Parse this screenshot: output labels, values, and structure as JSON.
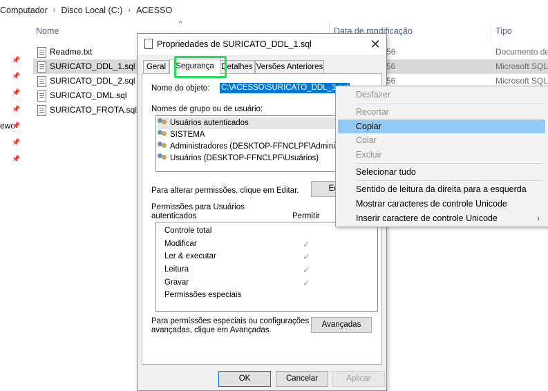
{
  "explorer": {
    "breadcrumb": [
      "Computador",
      "Disco Local (C:)",
      "ACESSO"
    ],
    "breadcrumb_sep": "›",
    "columns": {
      "name": "Nome",
      "date": "Data de modificação",
      "type": "Tipo"
    },
    "left_partial_text": "ewo",
    "files": [
      {
        "name": "Readme.txt",
        "date": "56",
        "type": "Documento de"
      },
      {
        "name": "SURICATO_DDL_1.sql",
        "date": "56",
        "type": "Microsoft SQL"
      },
      {
        "name": "SURICATO_DDL_2.sql",
        "date": "56",
        "type": "Microsoft SQL"
      },
      {
        "name": "SURICATO_DML.sql",
        "date": "",
        "type": ""
      },
      {
        "name": "SURICATO_FROTA.sql",
        "date": "",
        "type": ""
      }
    ]
  },
  "dialog": {
    "title": "Propriedades de SURICATO_DDL_1.sql",
    "close_glyph": "✕",
    "tabs": [
      "Geral",
      "Segurança",
      "Detalhes",
      "Versões Anteriores"
    ],
    "object_label": "Nome do objeto:",
    "object_value": "C:\\ACESSO\\SURICATO_DDL_1.sql",
    "groups_label": "Nomes de grupo ou de usuário:",
    "groups": [
      "Usuários autenticados",
      "SISTEMA",
      "Administradores (DESKTOP-FFNCLPF\\Administradores)",
      "Usuários (DESKTOP-FFNCLPF\\Usuários)"
    ],
    "change_hint": "Para alterar permissões, clique em Editar.",
    "edit_button": "Editar...",
    "perm_label_line1": "Permissões para Usuários",
    "perm_label_line2": "autenticados",
    "allow_header": "Permitir",
    "permissions": [
      {
        "name": "Controle total",
        "allowed": false
      },
      {
        "name": "Modificar",
        "allowed": true
      },
      {
        "name": "Ler & executar",
        "allowed": true
      },
      {
        "name": "Leitura",
        "allowed": true
      },
      {
        "name": "Gravar",
        "allowed": true
      },
      {
        "name": "Permissões especiais",
        "allowed": false
      }
    ],
    "special_hint_line1": "Para permissões especiais ou configurações",
    "special_hint_line2": "avançadas, clique em Avançadas.",
    "advanced_button": "Avançadas",
    "ok_button": "OK",
    "cancel_button": "Cancelar",
    "apply_button": "Aplicar"
  },
  "context_menu": {
    "items": [
      {
        "label": "Desfazer",
        "enabled": false
      },
      {
        "label": "Recortar",
        "enabled": false
      },
      {
        "label": "Copiar",
        "enabled": true,
        "highlighted": true
      },
      {
        "label": "Colar",
        "enabled": false
      },
      {
        "label": "Excluir",
        "enabled": false
      },
      {
        "label": "Selecionar tudo",
        "enabled": true
      },
      {
        "label": "Sentido de leitura da direita para a esquerda",
        "enabled": true
      },
      {
        "label": "Mostrar caracteres de controle Unicode",
        "enabled": true
      },
      {
        "label": "Inserir caractere de controle Unicode",
        "enabled": true,
        "submenu": true
      }
    ],
    "submenu_glyph": "›"
  },
  "colors": {
    "selection_blue": "#0078d7",
    "menu_highlight": "#91c9f7",
    "tab_outline": "#22e05a"
  }
}
